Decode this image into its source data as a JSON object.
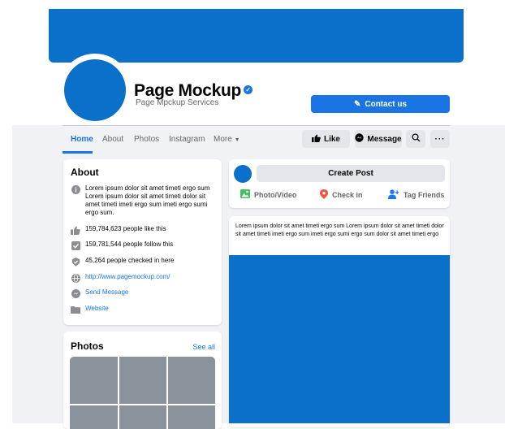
{
  "profile": {
    "name": "Page Mockup",
    "subtitle": "Page Mpckup Services",
    "contact_label": "Contact us",
    "cover_color": "#0b70c9"
  },
  "nav": {
    "tabs": [
      "Home",
      "About",
      "Photos",
      "Instagram",
      "More"
    ],
    "active_tab": "Home",
    "like_label": "Like",
    "message_label": "Message"
  },
  "about": {
    "title": "About",
    "description": "Lorem ipsum dolor sit amet timeti ergo sum Lorem ipsum dolor sit amet timeti dolor sit amet timeti imeti ergo sum imeti ergo sumi ergo sum.",
    "likes": "159,784,623 people like this",
    "follows": "159,781,544 people follow this",
    "checkins": "45,264 people checked in here",
    "url": "http://www.pagemockup.com/",
    "send_message": "Send Message",
    "website": "Website"
  },
  "photos": {
    "title": "Photos",
    "see_all": "See all"
  },
  "create_post": {
    "label": "Create Post",
    "actions": [
      "Photo/Video",
      "Check in",
      "Tag Friends"
    ]
  },
  "post": {
    "text": "Lorem ipsum dolor sit amet timeti ergo sum Lorem ipsum dolor sit amet timeti dolor sit amet timeti imeti ergo sum imeti ergo sumi ergo sum  dolor sit amet timeti ergo"
  },
  "colors": {
    "accent": "#1b74e4",
    "cover": "#0b70c9",
    "background": "#f0f2f5"
  }
}
